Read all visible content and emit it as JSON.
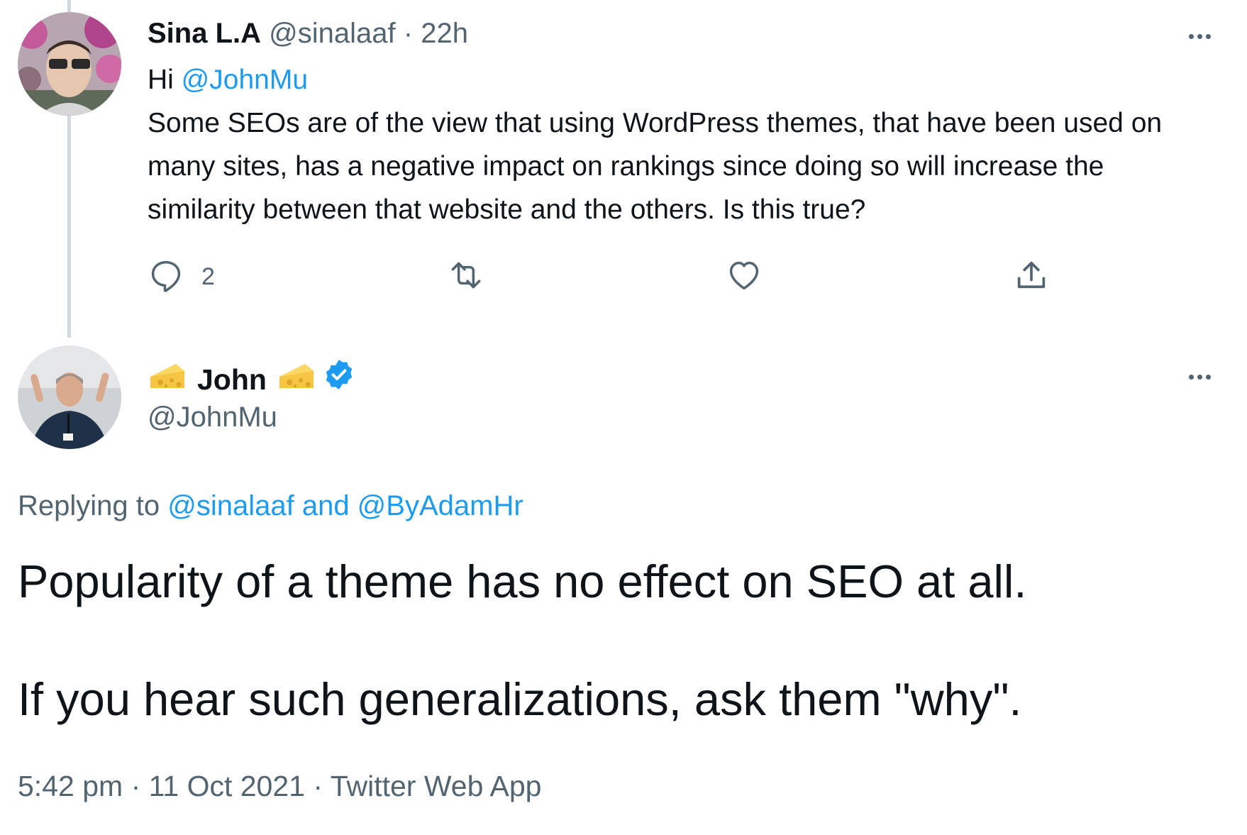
{
  "first_tweet": {
    "author_name": "Sina L.A",
    "handle": "@sinalaaf",
    "separator": "·",
    "time": "22h",
    "greeting": "Hi ",
    "mention": "@JohnMu",
    "text": "Some SEOs are of the view that using WordPress themes, that have been used on many sites, has a negative impact on rankings since doing so will increase the similarity between that website and the others. Is this true?",
    "reply_count": "2",
    "icons": [
      "reply-icon",
      "retweet-icon",
      "like-icon",
      "share-icon",
      "more-icon"
    ]
  },
  "second_tweet": {
    "author_name": "John",
    "name_emoji": "cheese-wedge-icon",
    "verified_icon": "verified-badge-icon",
    "handle": "@JohnMu",
    "replying_prefix": "Replying to ",
    "replying_users": "@sinalaaf and @ByAdamHr",
    "text_line1": "Popularity of a theme has no effect on SEO at all.",
    "text_line2": "If you hear such generalizations, ask them \"why\".",
    "time": "5:42 pm",
    "date": "11 Oct 2021",
    "source": "Twitter Web App",
    "separator": "·"
  },
  "colors": {
    "accent": "#1d9bf0",
    "muted": "#536471",
    "text": "#0f1419",
    "thread_line": "#cfd9de"
  }
}
